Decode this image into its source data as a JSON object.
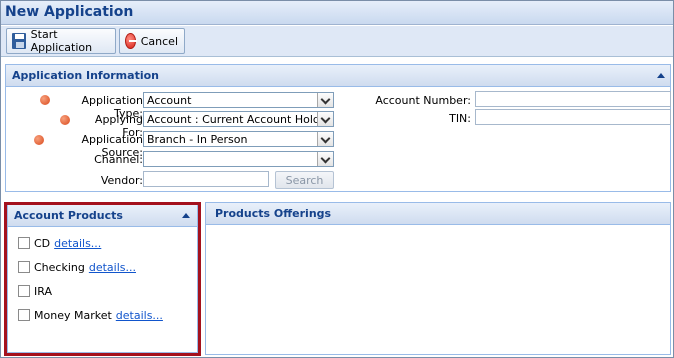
{
  "window": {
    "title": "New Application"
  },
  "toolbar": {
    "start_label": "Start Application",
    "cancel_label": "Cancel"
  },
  "app_info": {
    "title": "Application Information",
    "application_type": {
      "label": "Application Type:",
      "value": "Account"
    },
    "applying_for": {
      "label": "Applying For:",
      "value": "Account : Current Account Holder"
    },
    "application_source": {
      "label": "Application Source:",
      "value": "Branch - In Person"
    },
    "channel": {
      "label": "Channel:",
      "value": ""
    },
    "vendor": {
      "label": "Vendor:",
      "value": "",
      "search_label": "Search"
    },
    "account_number": {
      "label": "Account Number:",
      "value": ""
    },
    "tin": {
      "label": "TIN:",
      "value": ""
    }
  },
  "account_products": {
    "title": "Account Products",
    "items": [
      {
        "label": "CD",
        "link": "details...",
        "checked": false
      },
      {
        "label": "Checking",
        "link": "details...",
        "checked": false
      },
      {
        "label": "IRA",
        "link": "",
        "checked": false
      },
      {
        "label": "Money Market",
        "link": "details...",
        "checked": false
      }
    ]
  },
  "product_offerings": {
    "title": "Products Offerings"
  },
  "colors": {
    "title_text": "#15428b",
    "required": "#d9481b",
    "highlight": "#a4111d",
    "link": "#1155cc"
  }
}
